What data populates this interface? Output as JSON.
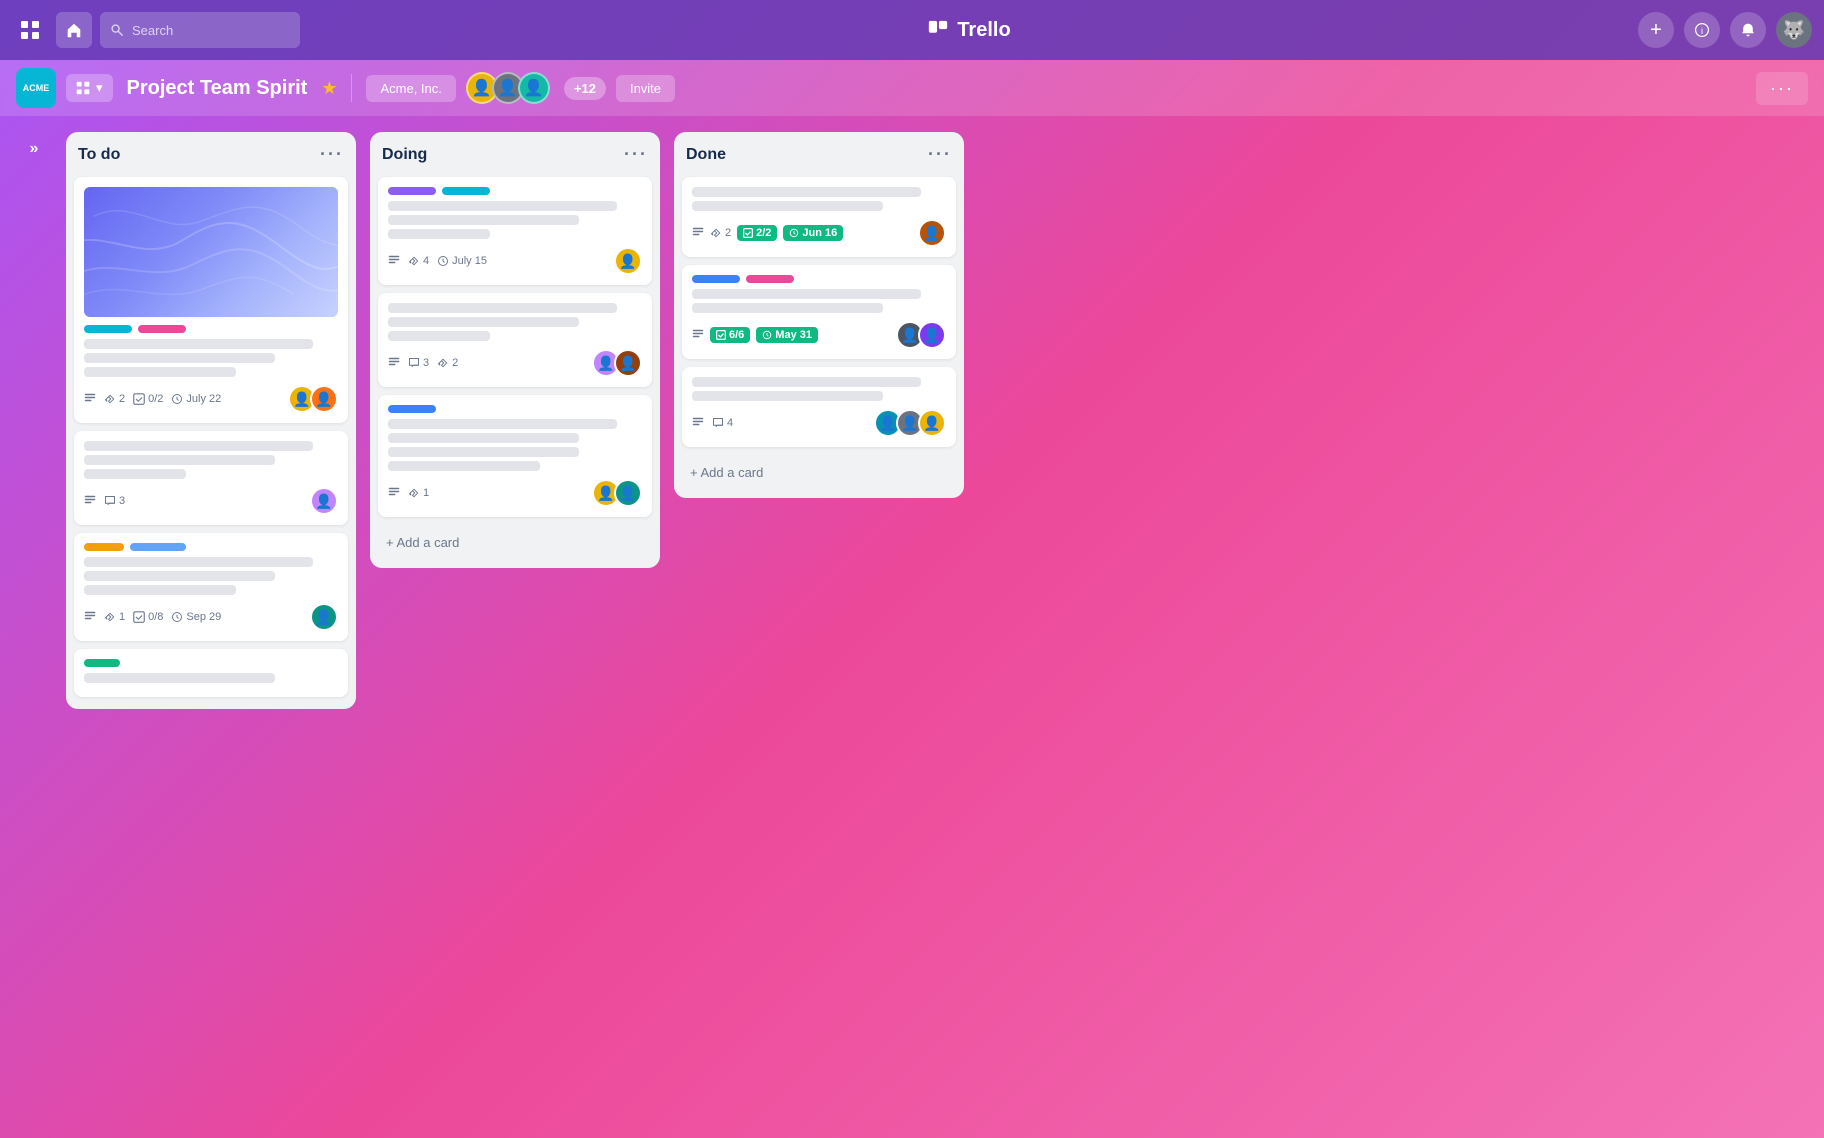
{
  "app": {
    "name": "Trello",
    "logo_unicode": "▣"
  },
  "nav": {
    "search_placeholder": "Search",
    "workspace_label": "ACME",
    "board_menu_icon": "≡",
    "board_menu_dropdown": "▾",
    "add_icon": "+",
    "info_icon": "ⓘ",
    "bell_icon": "🔔"
  },
  "board": {
    "title": "Project Team Spirit",
    "workspace": "Acme, Inc.",
    "member_count": "+12",
    "invite_label": "Invite",
    "more_label": "···"
  },
  "columns": [
    {
      "id": "todo",
      "title": "To do",
      "cards": [
        {
          "id": "todo-1",
          "has_cover": true,
          "tags": [
            "cyan",
            "pink"
          ],
          "lines": [
            "long",
            "medium",
            "short"
          ],
          "meta": {
            "description": true,
            "attachments": "2",
            "checklist": "0/2",
            "date": "July 22"
          },
          "avatars": [
            "yellow",
            "orange"
          ]
        },
        {
          "id": "todo-2",
          "has_cover": false,
          "tags": [],
          "lines": [
            "long",
            "medium",
            "xshort"
          ],
          "meta": {
            "description": true,
            "comments": "3"
          },
          "avatars": [
            "purple"
          ]
        },
        {
          "id": "todo-3",
          "has_cover": false,
          "tags": [
            "yellow",
            "blue2"
          ],
          "lines": [
            "long",
            "medium",
            "short"
          ],
          "meta": {
            "description": true,
            "attachments": "1",
            "checklist": "0/8",
            "date": "Sep 29"
          },
          "avatars": [
            "teal"
          ]
        },
        {
          "id": "todo-4",
          "has_cover": false,
          "tags": [
            "green"
          ],
          "lines": [
            "medium"
          ],
          "meta": {},
          "avatars": []
        }
      ]
    },
    {
      "id": "doing",
      "title": "Doing",
      "cards": [
        {
          "id": "doing-1",
          "has_cover": false,
          "tags": [
            "purple",
            "cyan"
          ],
          "lines": [
            "long",
            "medium",
            "xshort"
          ],
          "meta": {
            "description": true,
            "attachments": "4",
            "date": "July 15"
          },
          "avatars": [
            "yellow"
          ]
        },
        {
          "id": "doing-2",
          "has_cover": false,
          "tags": [],
          "lines": [
            "long",
            "medium",
            "xshort"
          ],
          "meta": {
            "description": true,
            "comments": "3",
            "attachments": "2"
          },
          "avatars": [
            "purple",
            "brown"
          ]
        },
        {
          "id": "doing-3",
          "has_cover": false,
          "tags": [
            "blue"
          ],
          "lines": [
            "long",
            "medium",
            "medium",
            "short"
          ],
          "meta": {
            "description": true,
            "attachments": "1"
          },
          "avatars": [
            "yellow",
            "teal"
          ]
        }
      ]
    },
    {
      "id": "done",
      "title": "Done",
      "cards": [
        {
          "id": "done-1",
          "has_cover": false,
          "tags": [],
          "lines": [
            "long",
            "medium"
          ],
          "meta": {
            "description": true,
            "attachments": "2",
            "checklist_done": "2/2",
            "date": "Jun 16"
          },
          "avatars": [
            "red_brown"
          ]
        },
        {
          "id": "done-2",
          "has_cover": false,
          "tags": [
            "blue",
            "pink"
          ],
          "lines": [
            "long",
            "medium"
          ],
          "meta": {
            "description": true,
            "checklist_done": "6/6",
            "date": "May 31"
          },
          "avatars": [
            "gray",
            "purple2"
          ]
        },
        {
          "id": "done-3",
          "has_cover": false,
          "tags": [],
          "lines": [
            "long",
            "medium"
          ],
          "meta": {
            "description": true,
            "comments": "4"
          },
          "avatars": [
            "teal2",
            "gray2",
            "yellow2"
          ]
        }
      ]
    }
  ],
  "add_card_label": "+ Add a card",
  "sidebar_toggle": "»"
}
